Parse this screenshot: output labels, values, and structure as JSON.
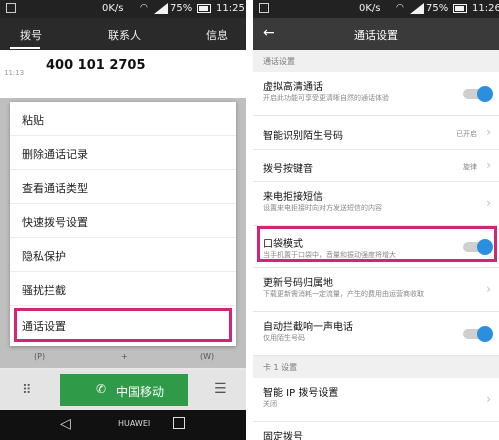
{
  "status": {
    "network": "0K/s",
    "battery": "75%",
    "time": "11:25",
    "time_right": "11:26"
  },
  "left": {
    "tabs": [
      "拨号",
      "联系人",
      "信息"
    ],
    "recent_time": "11:13",
    "recent_number": "400 101 2705",
    "menu": [
      "粘贴",
      "删除通话记录",
      "查看通话类型",
      "快速拨号设置",
      "隐私保护",
      "骚扰拦截",
      "通话设置"
    ],
    "keys": [
      "(P)",
      "+",
      "(W)"
    ],
    "call_button": "中国移动",
    "nav_home": "HUAWEI"
  },
  "right": {
    "title": "通话设置",
    "section1": "通话设置",
    "rows": [
      {
        "label": "虚拟高清通话",
        "sub": "开启此功能可享受更清晰自然的通话体验"
      },
      {
        "label": "智能识别陌生号码",
        "value": "已开启"
      },
      {
        "label": "拨号按键音",
        "value": "旋律"
      },
      {
        "label": "来电拒接短信",
        "sub": "设置来电拒接时向对方发送短信的内容"
      },
      {
        "label": "口袋模式",
        "sub": "当手机置于口袋中，音量和振动强度将增大"
      },
      {
        "label": "更新号码归属地",
        "sub": "下载更新需消耗一定流量，产生的费用由运营商收取"
      },
      {
        "label": "自动拦截响一声电话",
        "sub": "仅用陌生号码"
      }
    ],
    "section2": "卡 1 设置",
    "rows2": [
      {
        "label": "智能 IP 拨号设置",
        "sub": "关闭"
      },
      {
        "label": "固定拨号"
      }
    ]
  },
  "colors": {
    "highlight": "#d0267a",
    "toggle": "#2b8fe0",
    "call": "#2f9a47"
  }
}
